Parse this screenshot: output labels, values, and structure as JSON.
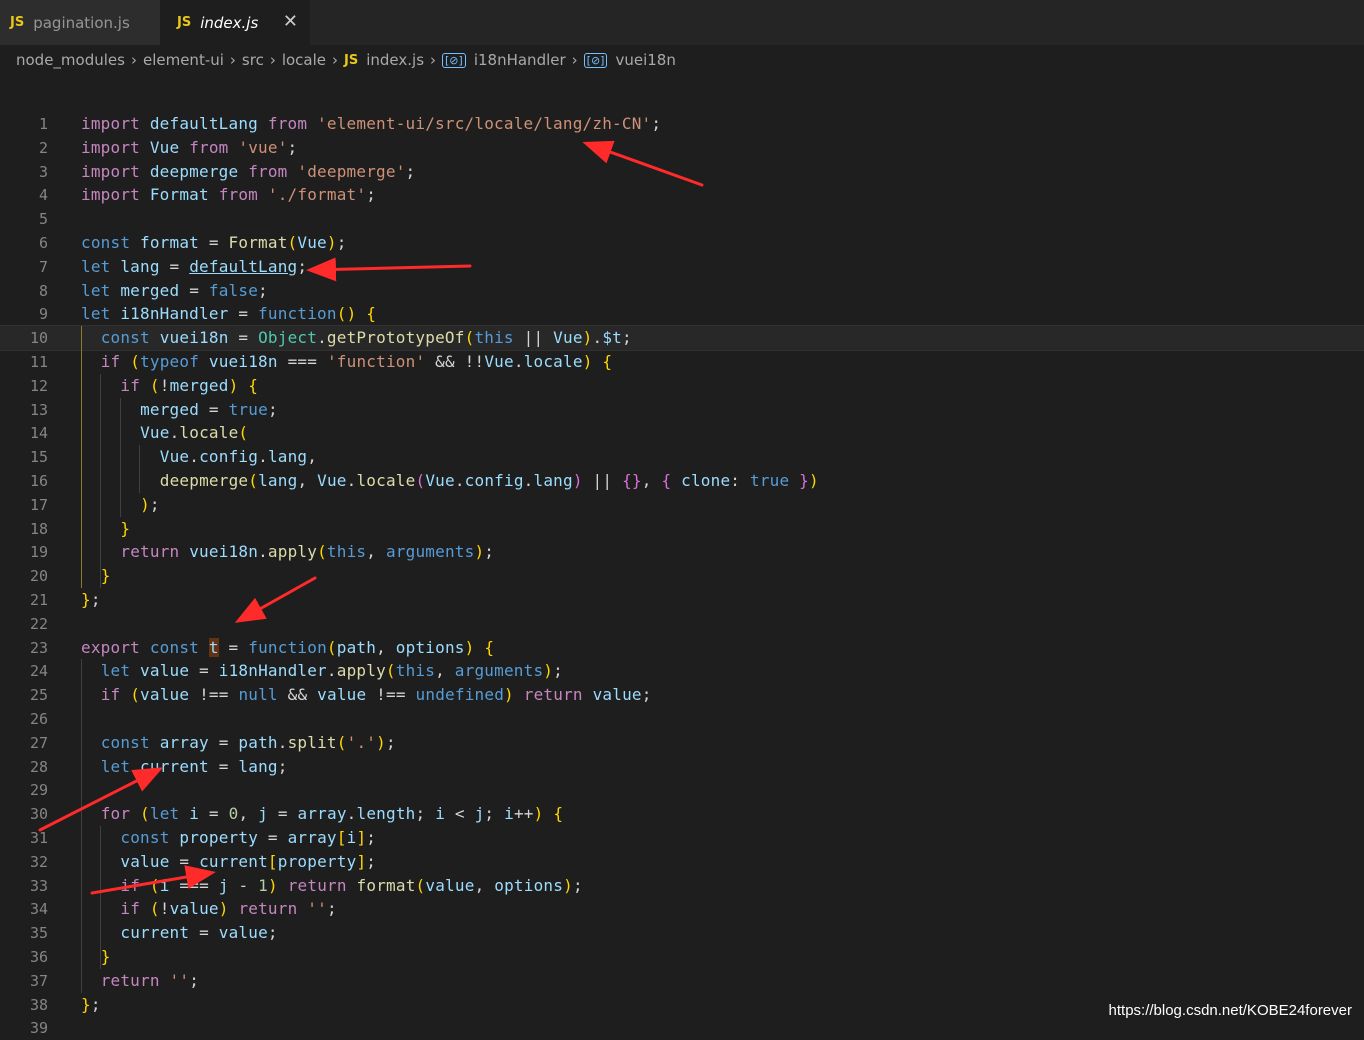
{
  "tabs": [
    {
      "icon": "JS",
      "label": "pagination.js",
      "active": false
    },
    {
      "icon": "JS",
      "label": "index.js",
      "active": true,
      "close": "✕"
    }
  ],
  "breadcrumb": {
    "items": [
      "node_modules",
      "element-ui",
      "src",
      "locale",
      "index.js",
      "i18nHandler",
      "vuei18n"
    ],
    "separator": "›",
    "file_icon": "JS",
    "symbol_icon": "[⊘]"
  },
  "lines": [
    {
      "n": "1",
      "code": "import defaultLang from 'element-ui/src/locale/lang/zh-CN';"
    },
    {
      "n": "2",
      "code": "import Vue from 'vue';"
    },
    {
      "n": "3",
      "code": "import deepmerge from 'deepmerge';"
    },
    {
      "n": "4",
      "code": "import Format from './format';"
    },
    {
      "n": "5",
      "code": ""
    },
    {
      "n": "6",
      "code": "const format = Format(Vue);"
    },
    {
      "n": "7",
      "code": "let lang = defaultLang;"
    },
    {
      "n": "8",
      "code": "let merged = false;"
    },
    {
      "n": "9",
      "code": "let i18nHandler = function() {"
    },
    {
      "n": "10",
      "code": "  const vuei18n = Object.getPrototypeOf(this || Vue).$t;"
    },
    {
      "n": "11",
      "code": "  if (typeof vuei18n === 'function' && !!Vue.locale) {"
    },
    {
      "n": "12",
      "code": "    if (!merged) {"
    },
    {
      "n": "13",
      "code": "      merged = true;"
    },
    {
      "n": "14",
      "code": "      Vue.locale("
    },
    {
      "n": "15",
      "code": "        Vue.config.lang,"
    },
    {
      "n": "16",
      "code": "        deepmerge(lang, Vue.locale(Vue.config.lang) || {}, { clone: true })"
    },
    {
      "n": "17",
      "code": "      );"
    },
    {
      "n": "18",
      "code": "    }"
    },
    {
      "n": "19",
      "code": "    return vuei18n.apply(this, arguments);"
    },
    {
      "n": "20",
      "code": "  }"
    },
    {
      "n": "21",
      "code": "};"
    },
    {
      "n": "22",
      "code": ""
    },
    {
      "n": "23",
      "code": "export const t = function(path, options) {"
    },
    {
      "n": "24",
      "code": "  let value = i18nHandler.apply(this, arguments);"
    },
    {
      "n": "25",
      "code": "  if (value !== null && value !== undefined) return value;"
    },
    {
      "n": "26",
      "code": ""
    },
    {
      "n": "27",
      "code": "  const array = path.split('.');"
    },
    {
      "n": "28",
      "code": "  let current = lang;"
    },
    {
      "n": "29",
      "code": ""
    },
    {
      "n": "30",
      "code": "  for (let i = 0, j = array.length; i < j; i++) {"
    },
    {
      "n": "31",
      "code": "    const property = array[i];"
    },
    {
      "n": "32",
      "code": "    value = current[property];"
    },
    {
      "n": "33",
      "code": "    if (i === j - 1) return format(value, options);"
    },
    {
      "n": "34",
      "code": "    if (!value) return '';"
    },
    {
      "n": "35",
      "code": "    current = value;"
    },
    {
      "n": "36",
      "code": "  }"
    },
    {
      "n": "37",
      "code": "  return '';"
    },
    {
      "n": "38",
      "code": "};"
    },
    {
      "n": "39",
      "code": ""
    }
  ],
  "annotation_color": "#ff2a2a",
  "watermark": "https://blog.csdn.net/KOBE24forever"
}
